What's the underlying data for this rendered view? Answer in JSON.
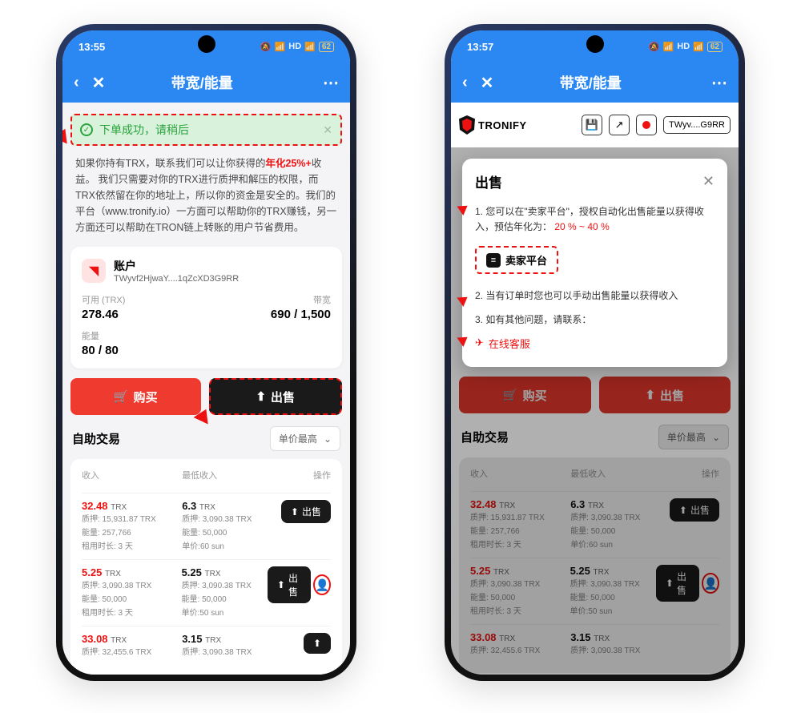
{
  "statusbar": {
    "time_left": "13:55",
    "time_right": "13:57",
    "battery": "62"
  },
  "navbar": {
    "title": "带宽/能量"
  },
  "toast": {
    "text": "下单成功，请稍后"
  },
  "promo": {
    "line1a": "如果你持有TRX，联系我们可以让你获得的",
    "highlight": "年化25%+",
    "line1b": "收益。",
    "rest": "我们只需要对你的TRX进行质押和解压的权限，而TRX依然留在你的地址上，所以你的资金是安全的。我们的平台（www.tronify.io）一方面可以帮助你的TRX赚钱，另一方面还可以帮助在TRON链上转账的用户节省费用。"
  },
  "account": {
    "title": "账户",
    "addr": "TWyvf2HjwaY....1qZcXD3G9RR",
    "available_label": "可用 (TRX)",
    "available": "278.46",
    "bandwidth_label": "带宽",
    "bandwidth": "690 / 1,500",
    "energy_label": "能量",
    "energy": "80 / 80"
  },
  "buttons": {
    "buy": "购买",
    "sell": "出售"
  },
  "trading": {
    "title": "自助交易",
    "sort": "单价最高",
    "cols": {
      "income": "收入",
      "min": "最低收入",
      "op": "操作"
    },
    "rows": [
      {
        "income": "32.48",
        "stake": "质押: 15,931.87 TRX",
        "energy": "能量: 257,766",
        "dur": "租用时长: 3 天",
        "min": "6.3",
        "min_stake": "质押: 3,090.38 TRX",
        "min_energy": "能量: 50,000",
        "min_price": "单价:60 sun"
      },
      {
        "income": "5.25",
        "stake": "质押: 3,090.38 TRX",
        "energy": "能量: 50,000",
        "dur": "租用时长: 3 天",
        "min": "5.25",
        "min_stake": "质押: 3,090.38 TRX",
        "min_energy": "能量: 50,000",
        "min_price": "单价:50 sun"
      },
      {
        "income": "33.08",
        "stake": "质押: 32,455.6 TRX",
        "energy": "",
        "dur": "",
        "min": "3.15",
        "min_stake": "质押: 3,090.38 TRX",
        "min_energy": "",
        "min_price": ""
      }
    ],
    "sell_pill": "出售"
  },
  "phone2": {
    "logo": "TRONIFY",
    "addr_short": "TWyv....G9RR",
    "modal": {
      "title": "出售",
      "step1a": "1. 您可以在\"卖家平台\"，授权自动化出售能量以获得收入，预估年化为：",
      "step1b": "20 % ~ 40 %",
      "seller_btn": "卖家平台",
      "step2": "2. 当有订单时您也可以手动出售能量以获得收入",
      "step3": "3. 如有其他问题，请联系：",
      "cs": "在线客服"
    }
  }
}
